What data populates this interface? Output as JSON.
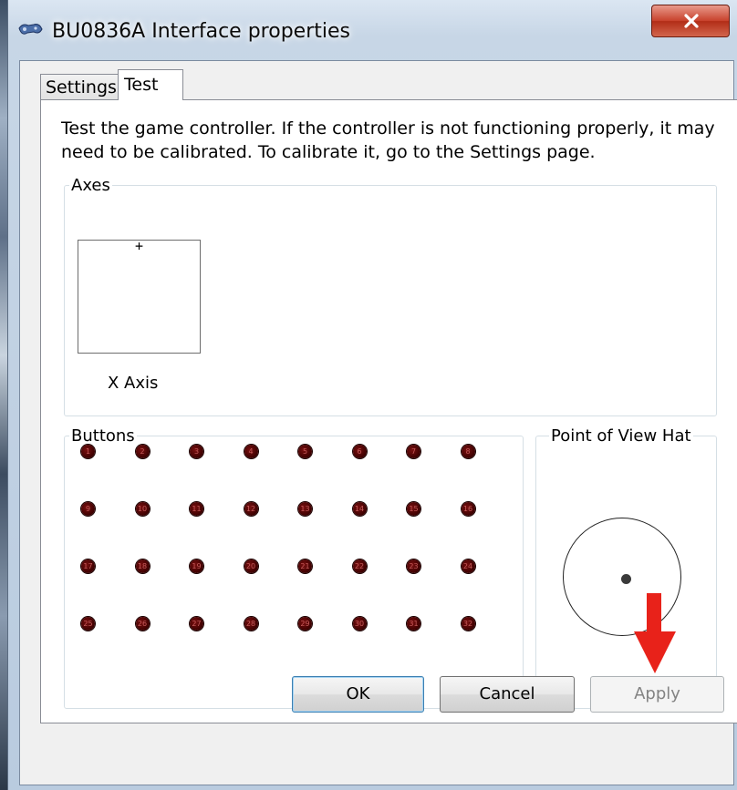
{
  "window": {
    "title": "BU0836A Interface properties",
    "close_icon": "close-icon"
  },
  "tabs": [
    {
      "label": "Settings",
      "active": false
    },
    {
      "label": "Test",
      "active": true
    }
  ],
  "test_page": {
    "description": "Test the game controller.  If the controller is not functioning properly, it may need to be calibrated.  To calibrate it, go to the Settings page.",
    "axes": {
      "group_label": "Axes",
      "x_axis_label": "X Axis",
      "crosshair": "+"
    },
    "buttons": {
      "group_label": "Buttons",
      "items": [
        "1",
        "2",
        "3",
        "4",
        "5",
        "6",
        "7",
        "8",
        "9",
        "10",
        "11",
        "12",
        "13",
        "14",
        "15",
        "16",
        "17",
        "18",
        "19",
        "20",
        "21",
        "22",
        "23",
        "24",
        "25",
        "26",
        "27",
        "28",
        "29",
        "30",
        "31",
        "32"
      ]
    },
    "pov_hat": {
      "group_label": "Point of View Hat"
    }
  },
  "dialog_buttons": {
    "ok": "OK",
    "cancel": "Cancel",
    "apply": "Apply",
    "apply_enabled": false
  },
  "annotation": {
    "arrow_icon": "red-down-arrow-icon",
    "arrow_color": "#e8221a"
  },
  "colors": {
    "button_indicator": "#5a0a0a",
    "title_close": "#c8412b",
    "ok_border": "#3c7fb1"
  }
}
